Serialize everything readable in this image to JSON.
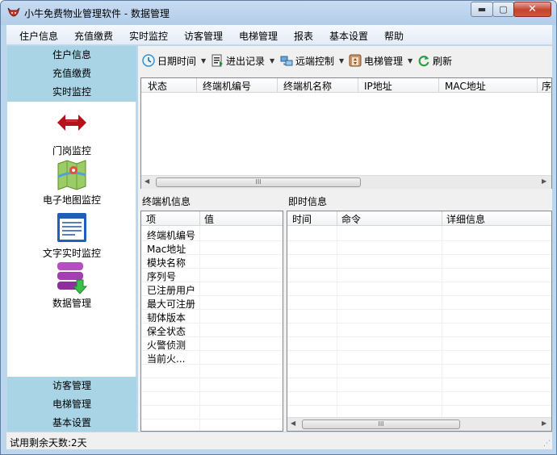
{
  "window": {
    "title": "小牛免费物业管理软件 - 数据管理",
    "min_glyph": "▬",
    "max_glyph": "▢",
    "close_glyph": "✕"
  },
  "menu": [
    "住户信息",
    "充值缴费",
    "实时监控",
    "访客管理",
    "电梯管理",
    "报表",
    "基本设置",
    "帮助"
  ],
  "sidebar": {
    "categories_top": [
      "住户信息",
      "充值缴费",
      "实时监控"
    ],
    "tiles": [
      {
        "label": "门岗监控",
        "icon": "double-arrow-icon"
      },
      {
        "label": "电子地图监控",
        "icon": "map-icon"
      },
      {
        "label": "文字实时监控",
        "icon": "text-window-icon"
      },
      {
        "label": "数据管理",
        "icon": "database-icon"
      }
    ],
    "categories_bottom": [
      "访客管理",
      "电梯管理",
      "基本设置"
    ]
  },
  "toolbar": {
    "items": [
      {
        "label": "日期时间",
        "icon": "clock-icon",
        "dropdown": true
      },
      {
        "label": "进出记录",
        "icon": "record-icon",
        "dropdown": true
      },
      {
        "label": "远端控制",
        "icon": "remote-icon",
        "dropdown": true
      },
      {
        "label": "电梯管理",
        "icon": "elevator-icon",
        "dropdown": true
      },
      {
        "label": "刷新",
        "icon": "refresh-icon",
        "dropdown": false
      }
    ]
  },
  "terminal_table": {
    "columns": [
      "状态",
      "终端机编号",
      "终端机名称",
      "IP地址",
      "MAC地址",
      "序"
    ],
    "rows": [],
    "scroll_grip": "III"
  },
  "terminal_info": {
    "title": "终端机信息",
    "columns": [
      "项",
      "值"
    ],
    "items": [
      "终端机编号",
      "Mac地址",
      "模块名称",
      "序列号",
      "已注册用户",
      "最大可注册",
      "韧体版本",
      "保全状态",
      "火警侦测",
      "当前火..."
    ]
  },
  "instant_info": {
    "title": "即时信息",
    "columns": [
      "时间",
      "命令",
      "详细信息"
    ],
    "rows": []
  },
  "status": {
    "text": "试用剩余天数:2天"
  },
  "colors": {
    "sidebar_category": "#a9d4e5",
    "window_frame": "#bcd6ee",
    "close_button": "#c4432d"
  }
}
